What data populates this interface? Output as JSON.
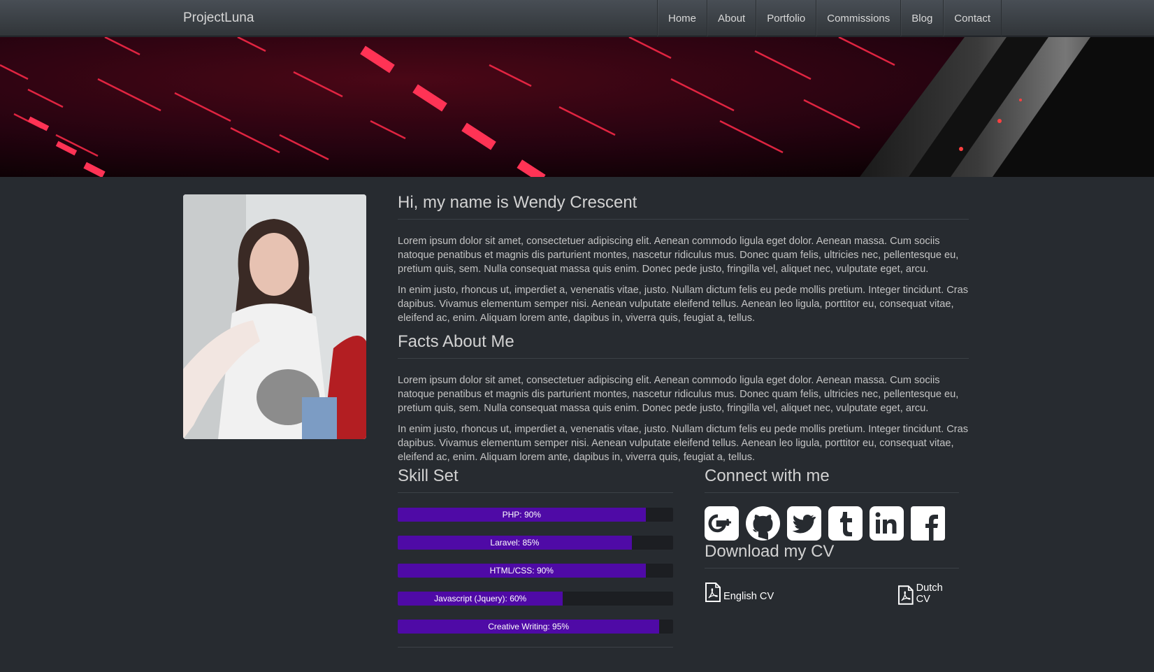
{
  "navbar": {
    "brand": "ProjectLuna",
    "items": [
      "Home",
      "About",
      "Portfolio",
      "Commissions",
      "Blog",
      "Contact"
    ]
  },
  "about": {
    "heading": "Hi, my name is Wendy Crescent",
    "paragraphs": [
      "Lorem ipsum dolor sit amet, consectetuer adipiscing elit. Aenean commodo ligula eget dolor. Aenean massa. Cum sociis natoque penatibus et magnis dis parturient montes, nascetur ridiculus mus. Donec quam felis, ultricies nec, pellentesque eu, pretium quis, sem. Nulla consequat massa quis enim. Donec pede justo, fringilla vel, aliquet nec, vulputate eget, arcu.",
      "In enim justo, rhoncus ut, imperdiet a, venenatis vitae, justo. Nullam dictum felis eu pede mollis pretium. Integer tincidunt. Cras dapibus. Vivamus elementum semper nisi. Aenean vulputate eleifend tellus. Aenean leo ligula, porttitor eu, consequat vitae, eleifend ac, enim. Aliquam lorem ante, dapibus in, viverra quis, feugiat a, tellus."
    ]
  },
  "facts": {
    "heading": "Facts About Me",
    "paragraphs": [
      "Lorem ipsum dolor sit amet, consectetuer adipiscing elit. Aenean commodo ligula eget dolor. Aenean massa. Cum sociis natoque penatibus et magnis dis parturient montes, nascetur ridiculus mus. Donec quam felis, ultricies nec, pellentesque eu, pretium quis, sem. Nulla consequat massa quis enim. Donec pede justo, fringilla vel, aliquet nec, vulputate eget, arcu.",
      "In enim justo, rhoncus ut, imperdiet a, venenatis vitae, justo. Nullam dictum felis eu pede mollis pretium. Integer tincidunt. Cras dapibus. Vivamus elementum semper nisi. Aenean vulputate eleifend tellus. Aenean leo ligula, porttitor eu, consequat vitae, eleifend ac, enim. Aliquam lorem ante, dapibus in, viverra quis, feugiat a, tellus."
    ]
  },
  "skills": {
    "heading": "Skill Set",
    "bar_color": "#4f0aa6",
    "items": [
      {
        "label": "PHP: 90%",
        "percent": 90
      },
      {
        "label": "Laravel: 85%",
        "percent": 85
      },
      {
        "label": "HTML/CSS: 90%",
        "percent": 90
      },
      {
        "label": "Javascript (Jquery): 60%",
        "percent": 60
      },
      {
        "label": "Creative Writing: 95%",
        "percent": 95
      }
    ]
  },
  "connect": {
    "heading": "Connect with me",
    "icons": [
      "google-plus-icon",
      "github-icon",
      "twitter-icon",
      "tumblr-icon",
      "linkedin-icon",
      "facebook-icon"
    ]
  },
  "cv": {
    "heading": "Download my CV",
    "english": "English CV",
    "dutch": "Dutch CV"
  }
}
